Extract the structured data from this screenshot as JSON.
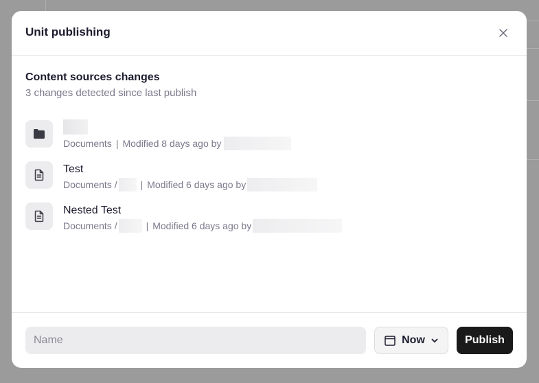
{
  "modal": {
    "title": "Unit publishing"
  },
  "section": {
    "title": "Content sources changes",
    "subtitle": "3 changes detected since last publish"
  },
  "changes": [
    {
      "icon": "folder-icon",
      "name": "",
      "location": "Documents",
      "modified": "Modified 8 days ago by"
    },
    {
      "icon": "document-icon",
      "name": "Test",
      "location": "Documents /",
      "modified": "Modified 6 days ago by"
    },
    {
      "icon": "document-icon",
      "name": "Nested Test",
      "location": "Documents /",
      "modified": "Modified 6 days ago by"
    }
  ],
  "footer": {
    "name_placeholder": "Name",
    "schedule_label": "Now",
    "publish_label": "Publish"
  },
  "colors": {
    "primary_button": "#1a1a1a",
    "muted_text": "#7a7a8c",
    "overlay": "#9b9b9b"
  }
}
